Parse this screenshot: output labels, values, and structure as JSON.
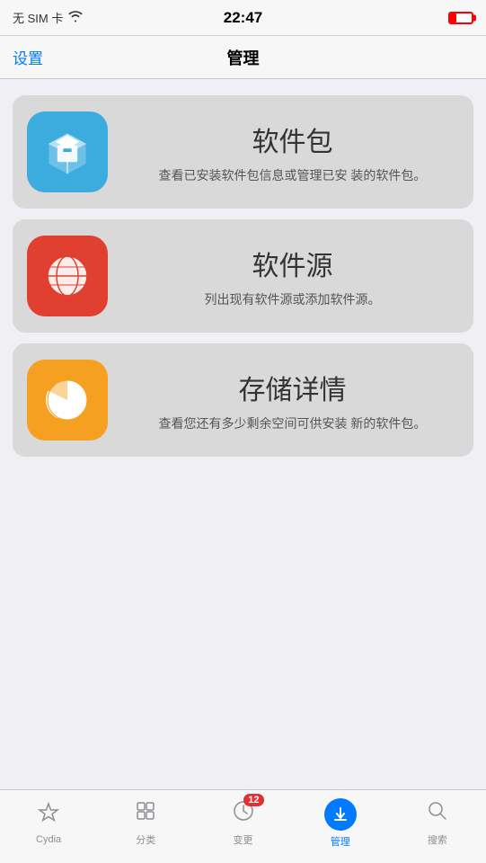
{
  "statusBar": {
    "carrier": "无 SIM 卡",
    "time": "22:47"
  },
  "navBar": {
    "back": "设置",
    "title": "管理"
  },
  "cards": [
    {
      "id": "packages",
      "title": "软件包",
      "desc": "查看已安装软件包信息或管理已安\n装的软件包。",
      "iconColor": "blue"
    },
    {
      "id": "sources",
      "title": "软件源",
      "desc": "列出现有软件源或添加软件源。",
      "iconColor": "red"
    },
    {
      "id": "storage",
      "title": "存储详情",
      "desc": "查看您还有多少剩余空间可供安装\n新的软件包。",
      "iconColor": "orange"
    }
  ],
  "tabBar": {
    "items": [
      {
        "id": "cydia",
        "label": "Cydia",
        "icon": "star"
      },
      {
        "id": "sections",
        "label": "分类",
        "icon": "sections"
      },
      {
        "id": "changes",
        "label": "变更",
        "icon": "clock",
        "badge": "12"
      },
      {
        "id": "manage",
        "label": "管理",
        "icon": "download",
        "active": true
      },
      {
        "id": "search",
        "label": "搜索",
        "icon": "search"
      }
    ]
  }
}
